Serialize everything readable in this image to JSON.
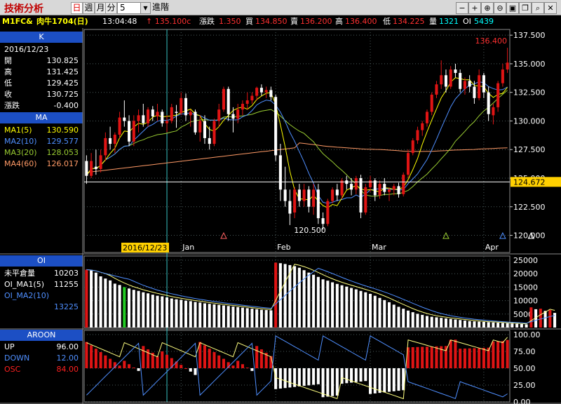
{
  "window": {
    "title": "技術分析"
  },
  "period": {
    "buttons": [
      "日",
      "週",
      "月",
      "分"
    ],
    "selected": "日",
    "interval": "5",
    "tick_label": "進階"
  },
  "toolbar": {
    "icons": [
      "minus-icon",
      "plus-icon",
      "zoom-in-icon",
      "zoom-out-icon",
      "save-icon",
      "copy-icon",
      "search-icon",
      "close-icon"
    ]
  },
  "quote": {
    "symbol": "M1FC&",
    "name": "肉牛1704(日)",
    "time": "13:04:48",
    "price_label": "↑ 135.100c",
    "change_label": "漲跌",
    "change": "1.350",
    "bid_label": "買",
    "bid": "134.850",
    "ask_label": "賣",
    "ask": "136.200",
    "high_label": "高",
    "high": "136.400",
    "low_label": "低",
    "low": "134.225",
    "vol_label": "量",
    "vol": "1321",
    "oi_label": "OI",
    "oi": "5439"
  },
  "kpanel": {
    "header": "K",
    "date": "2016/12/23",
    "rows": [
      {
        "label": "開",
        "value": "130.825"
      },
      {
        "label": "高",
        "value": "131.425"
      },
      {
        "label": "低",
        "value": "129.425"
      },
      {
        "label": "收",
        "value": "130.725"
      },
      {
        "label": "漲跌",
        "value": "-0.400"
      }
    ]
  },
  "mapanel": {
    "header": "MA",
    "rows": [
      {
        "label": "MA1(5)",
        "value": "130.590",
        "color": "#ffff00"
      },
      {
        "label": "MA2(10)",
        "value": "129.577",
        "color": "#4f8fff"
      },
      {
        "label": "MA3(20)",
        "value": "128.053",
        "color": "#9acd32"
      },
      {
        "label": "MA4(60)",
        "value": "126.017",
        "color": "#ff9a66"
      }
    ]
  },
  "oipanel": {
    "header": "OI",
    "rows": [
      {
        "label": "未平倉量",
        "value": "10203",
        "color": "#ffffff"
      },
      {
        "label": "OI_MA1(5)",
        "value": "11255",
        "color": "#ffffff"
      },
      {
        "label": "OI_MA2(10)",
        "value": "",
        "color": "#4f8fff"
      },
      {
        "label": "",
        "value": "13225",
        "color": "#4f8fff"
      }
    ]
  },
  "aroonpanel": {
    "header": "AROON",
    "rows": [
      {
        "label": "UP",
        "value": "96.00",
        "color": "#ffffff"
      },
      {
        "label": "DOWN",
        "value": "12.00",
        "color": "#4f8fff"
      },
      {
        "label": "OSC",
        "value": "84.00",
        "color": "#ff2020"
      }
    ]
  },
  "colors": {
    "up": "#e01414",
    "down": "#ffffff",
    "ma1": "#ffff00",
    "ma2": "#4f8fff",
    "ma3": "#9acd32",
    "ma4": "#ff9a66",
    "grid": "#4a5a5a",
    "axis": "#ffffff",
    "cursor": "#37c3c3"
  },
  "axes": {
    "price_ticks": [
      "137.500",
      "135.000",
      "132.500",
      "130.000",
      "127.500",
      "125.000",
      "122.500",
      "120.000"
    ],
    "oi_ticks": [
      "25000",
      "20000",
      "15000",
      "10000",
      "5000"
    ],
    "aroon_ticks": [
      "100.00",
      "75.00",
      "50.00",
      "25.00",
      "0.00"
    ],
    "months": [
      "Jan",
      "Feb",
      "Mar",
      "Apr"
    ],
    "cursor_date": "2016/12/23",
    "last_price": "124.672",
    "max_label": "136.400",
    "min_label": "120.500"
  },
  "chart_data": [
    {
      "type": "candlestick",
      "title": "K",
      "ylim": [
        118.5,
        138
      ],
      "last_price": 124.672,
      "ohlc": [
        [
          126.5,
          127.0,
          124.5,
          125.2
        ],
        [
          125.2,
          127.2,
          125.0,
          126.5
        ],
        [
          126.0,
          127.5,
          125.3,
          125.8
        ],
        [
          125.8,
          127.5,
          125.5,
          127.0
        ],
        [
          127.0,
          129.0,
          126.5,
          128.5
        ],
        [
          128.5,
          129.5,
          127.5,
          128.0
        ],
        [
          128.0,
          129.0,
          127.2,
          128.8
        ],
        [
          128.8,
          130.8,
          128.5,
          130.3
        ],
        [
          130.3,
          131.8,
          129.5,
          130.0
        ],
        [
          130.0,
          130.5,
          127.8,
          128.2
        ],
        [
          128.2,
          130.5,
          127.8,
          130.0
        ],
        [
          130.0,
          131.0,
          129.0,
          130.5
        ],
        [
          130.5,
          131.5,
          129.5,
          129.8
        ],
        [
          129.8,
          131.2,
          129.5,
          131.0
        ],
        [
          131.0,
          131.3,
          130.0,
          130.4
        ],
        [
          130.4,
          131.5,
          130.0,
          130.8
        ],
        [
          130.8,
          131.0,
          129.5,
          129.8
        ],
        [
          129.8,
          130.5,
          129.0,
          130.0
        ],
        [
          130.0,
          131.5,
          129.8,
          131.2
        ],
        [
          130.8,
          131.4,
          129.4,
          130.7
        ],
        [
          130.7,
          132.5,
          130.5,
          132.0
        ],
        [
          132.0,
          132.4,
          130.0,
          130.5
        ],
        [
          130.5,
          131.0,
          129.5,
          130.8
        ],
        [
          130.8,
          131.0,
          128.8,
          129.0
        ],
        [
          129.0,
          130.5,
          128.2,
          130.0
        ],
        [
          130.0,
          130.5,
          128.0,
          128.5
        ],
        [
          128.5,
          129.5,
          127.5,
          128.0
        ],
        [
          128.0,
          130.2,
          127.8,
          130.0
        ],
        [
          130.0,
          131.5,
          129.5,
          131.0
        ],
        [
          131.0,
          133.0,
          130.8,
          132.8
        ],
        [
          132.8,
          133.0,
          130.0,
          130.6
        ],
        [
          130.6,
          131.2,
          129.0,
          130.2
        ],
        [
          130.2,
          131.5,
          129.8,
          131.0
        ],
        [
          131.0,
          131.8,
          130.5,
          131.5
        ],
        [
          131.5,
          132.5,
          131.0,
          131.8
        ],
        [
          131.8,
          132.5,
          131.5,
          132.2
        ],
        [
          132.2,
          133.0,
          131.8,
          132.9
        ],
        [
          132.9,
          133.2,
          132.2,
          132.5
        ],
        [
          132.5,
          133.0,
          132.0,
          132.7
        ],
        [
          132.7,
          133.0,
          131.8,
          132.1
        ],
        [
          132.1,
          132.3,
          126.5,
          127.0
        ],
        [
          127.0,
          128.0,
          123.0,
          124.0
        ],
        [
          124.0,
          126.0,
          122.5,
          123.0
        ],
        [
          123.0,
          124.0,
          120.9,
          121.9
        ],
        [
          122.0,
          124.2,
          121.5,
          124.0
        ],
        [
          124.0,
          124.5,
          122.5,
          123.0
        ],
        [
          123.0,
          124.5,
          122.5,
          124.0
        ],
        [
          124.0,
          124.3,
          122.0,
          122.5
        ],
        [
          122.5,
          124.5,
          121.8,
          124.0
        ],
        [
          124.0,
          124.5,
          121.0,
          121.5
        ],
        [
          121.5,
          122.0,
          120.5,
          121.0
        ],
        [
          121.0,
          123.2,
          120.8,
          123.0
        ],
        [
          123.0,
          124.2,
          122.8,
          124.0
        ],
        [
          124.0,
          124.5,
          123.0,
          123.5
        ],
        [
          123.5,
          125.0,
          123.2,
          124.8
        ],
        [
          124.8,
          125.2,
          124.0,
          124.5
        ],
        [
          124.5,
          125.0,
          123.5,
          124.0
        ],
        [
          124.0,
          125.2,
          123.6,
          125.0
        ],
        [
          125.0,
          125.3,
          121.5,
          122.0
        ],
        [
          122.0,
          124.5,
          121.8,
          124.2
        ],
        [
          124.2,
          125.2,
          123.8,
          124.8
        ],
        [
          124.8,
          125.0,
          123.0,
          123.5
        ],
        [
          123.5,
          124.8,
          123.2,
          124.5
        ],
        [
          124.5,
          125.0,
          123.5,
          123.8
        ],
        [
          123.8,
          124.2,
          123.0,
          124.0
        ],
        [
          124.0,
          124.5,
          123.5,
          124.3
        ],
        [
          124.3,
          124.6,
          123.3,
          123.6
        ],
        [
          123.6,
          125.5,
          123.4,
          125.3
        ],
        [
          125.3,
          127.5,
          125.0,
          127.2
        ],
        [
          127.2,
          128.5,
          127.0,
          128.3
        ],
        [
          128.3,
          129.5,
          128.0,
          129.2
        ],
        [
          129.2,
          130.0,
          128.7,
          129.8
        ],
        [
          129.8,
          131.0,
          129.5,
          130.8
        ],
        [
          130.8,
          132.5,
          130.5,
          132.3
        ],
        [
          132.3,
          133.5,
          132.0,
          133.2
        ],
        [
          133.2,
          135.3,
          132.8,
          134.0
        ],
        [
          134.0,
          134.5,
          132.5,
          133.0
        ],
        [
          133.0,
          134.8,
          132.8,
          134.5
        ],
        [
          134.5,
          135.0,
          133.8,
          134.2
        ],
        [
          134.2,
          134.5,
          132.5,
          132.8
        ],
        [
          132.8,
          133.8,
          132.3,
          133.5
        ],
        [
          133.5,
          134.0,
          132.5,
          133.0
        ],
        [
          133.0,
          133.5,
          131.5,
          132.0
        ],
        [
          132.0,
          134.5,
          131.8,
          134.0
        ],
        [
          134.0,
          134.2,
          132.0,
          132.5
        ],
        [
          132.5,
          133.0,
          130.0,
          130.6
        ],
        [
          130.5,
          131.5,
          129.7,
          131.2
        ],
        [
          131.2,
          133.5,
          130.8,
          133.3
        ],
        [
          133.3,
          135.0,
          133.0,
          134.5
        ],
        [
          134.5,
          136.4,
          134.2,
          135.1
        ]
      ]
    },
    {
      "type": "bar",
      "title": "OI",
      "ylim": [
        0,
        25000
      ],
      "values": [
        21500,
        21200,
        20400,
        19000,
        18200,
        17500,
        16300,
        15800,
        15000,
        14500,
        14000,
        13600,
        13100,
        12700,
        12200,
        11800,
        11600,
        11200,
        10800,
        10500,
        10300,
        10000,
        9800,
        9500,
        9300,
        9000,
        8800,
        8600,
        8400,
        8200,
        8000,
        7800,
        7600,
        7400,
        7200,
        7000,
        6800,
        6600,
        6500,
        6400,
        24100,
        23900,
        23600,
        23200,
        22800,
        22200,
        21300,
        20400,
        19600,
        18800,
        17900,
        17400,
        16800,
        16200,
        15700,
        15200,
        14700,
        14200,
        13600,
        13100,
        12500,
        11800,
        11000,
        10200,
        9400,
        8500,
        7700,
        7000,
        6300,
        5700,
        5100,
        4700,
        4300,
        4000,
        3800,
        3600,
        3400,
        3200,
        3000,
        2800,
        2600,
        2400,
        2300,
        2200,
        2100,
        2000,
        1900,
        1800,
        1700,
        1600,
        1500,
        1400,
        1300,
        1200,
        7500,
        6800,
        7000,
        6200,
        6500,
        5439
      ]
    },
    {
      "type": "line",
      "title": "AROON",
      "ylim": [
        0,
        100
      ],
      "series": [
        {
          "name": "UP",
          "values": [
            96
          ]
        },
        {
          "name": "DOWN",
          "values": [
            12
          ]
        },
        {
          "name": "OSC",
          "values": [
            84
          ]
        }
      ]
    }
  ]
}
